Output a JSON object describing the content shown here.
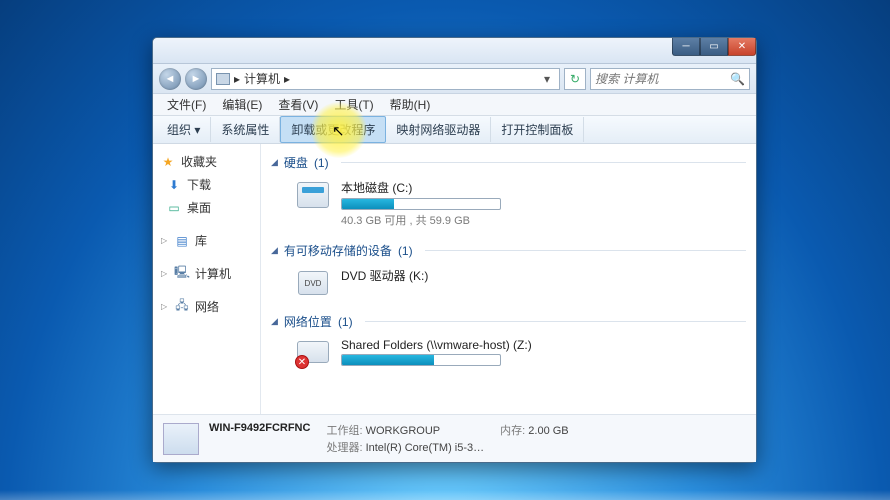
{
  "titlebar": {},
  "nav": {
    "address_icon_label": "计算机",
    "address_sep": "▸",
    "search_placeholder": "搜索 计算机"
  },
  "menu": {
    "file": "文件(F)",
    "edit": "编辑(E)",
    "view": "查看(V)",
    "tools": "工具(T)",
    "help": "帮助(H)"
  },
  "toolbar": {
    "organize": "组织 ▾",
    "sysprops": "系统属性",
    "uninstall": "卸载或更改程序",
    "mapdrive": "映射网络驱动器",
    "controlpanel": "打开控制面板"
  },
  "navpane": {
    "favorites": "收藏夹",
    "downloads": "下载",
    "desktop": "桌面",
    "libraries": "库",
    "computer": "计算机",
    "network": "网络"
  },
  "groups": {
    "hdd": {
      "label": "硬盘",
      "count": "(1)"
    },
    "removable": {
      "label": "有可移动存储的设备",
      "count": "(1)"
    },
    "netloc": {
      "label": "网络位置",
      "count": "(1)"
    }
  },
  "hdd_item": {
    "name": "本地磁盘 (C:)",
    "subtitle": "40.3 GB 可用 , 共 59.9 GB",
    "fill_pct": 33
  },
  "dvd_item": {
    "name": "DVD 驱动器 (K:)",
    "badge": "DVD"
  },
  "net_item": {
    "name": "Shared Folders (\\\\vmware-host) (Z:)",
    "fill_pct": 58
  },
  "details": {
    "name": "WIN-F9492FCRFNC",
    "workgroup_label": "工作组:",
    "workgroup": "WORKGROUP",
    "cpu_label": "处理器:",
    "cpu": "Intel(R) Core(TM) i5-3…",
    "mem_label": "内存:",
    "mem": "2.00 GB"
  }
}
